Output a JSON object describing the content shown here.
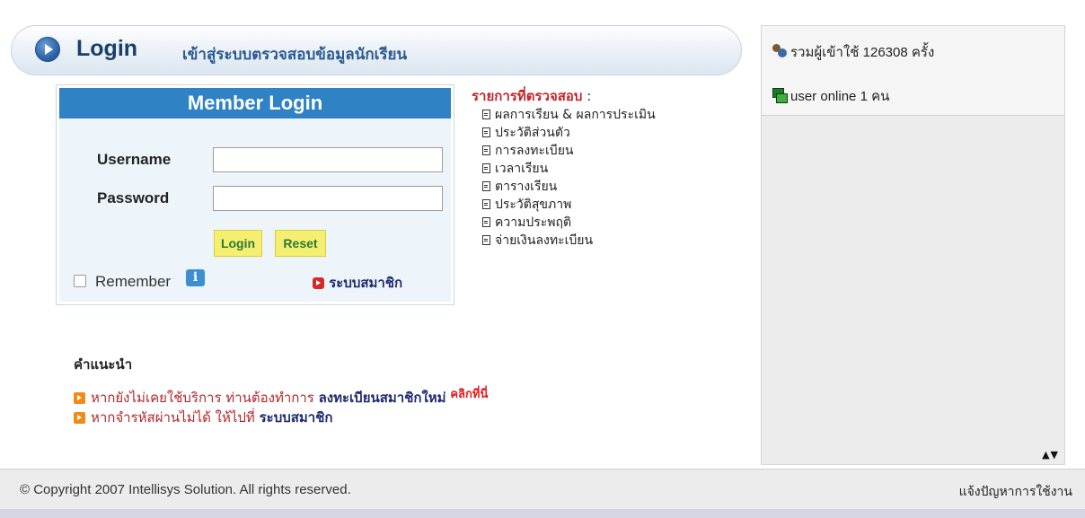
{
  "header": {
    "title": "Login",
    "subtitle": "เข้าสู่ระบบตรวจสอบข้อมูลนักเรียน"
  },
  "member_login": {
    "heading": "Member Login",
    "username_label": "Username",
    "username_value": "",
    "password_label": "Password",
    "password_value": "",
    "login_button": "Login",
    "reset_button": "Reset",
    "remember_label": "Remember",
    "remember_checked": false,
    "info_icon_glyph": "i",
    "member_system_link": "ระบบสมาชิก"
  },
  "check_items": {
    "title": "รายการที่ตรวจสอบ",
    "colon": " :",
    "items": [
      "ผลการเรียน & ผลการประเมิน",
      "ประวัติส่วนตัว",
      "การลงทะเบียน",
      "เวลาเรียน",
      "ตารางเรียน",
      "ประวัติสุขภาพ",
      "ความประพฤติ",
      "จ่ายเงินลงทะเบียน"
    ]
  },
  "advice": {
    "title": "คำแนะนำ",
    "line1_text": "หากยังไม่เคยใช้บริการ ท่านต้องทำการ ",
    "line1_link": "ลงทะเบียนสมาชิกใหม่",
    "line1_click": "คลิกที่นี่",
    "line2_text": "หากจำรหัสผ่านไม่ได้ ให้ไปที่ ",
    "line2_link": "ระบบสมาชิก"
  },
  "stats": {
    "visitors_prefix": "รวมผู้เข้าใช้",
    "visitors_count": "126308",
    "visitors_suffix": "ครั้ง",
    "online_prefix": "user online",
    "online_count": "1",
    "online_suffix": "คน",
    "scroll_arrows": "▲▼"
  },
  "footer": {
    "copyright": "© Copyright 2007 Intellisys Solution. All rights reserved.",
    "report_link": "แจ้งปัญหาการใช้งาน"
  },
  "colors": {
    "member_header": "#2f82c4",
    "button_bg": "#f4ee73",
    "accent_red": "#c2262b",
    "link_navy": "#1e2a6e"
  }
}
